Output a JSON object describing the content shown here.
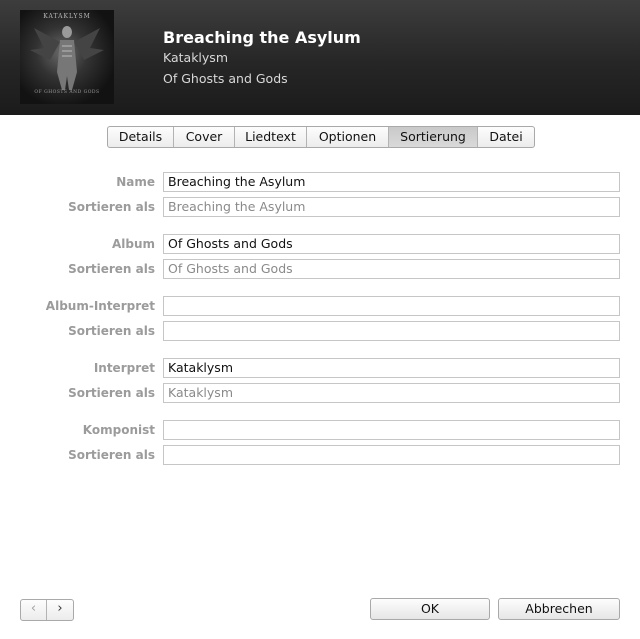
{
  "header": {
    "band_logo": "KATAKLYSM",
    "art_subtitle": "OF GHOSTS AND GODS",
    "title": "Breaching the Asylum",
    "artist": "Kataklysm",
    "album": "Of Ghosts and Gods"
  },
  "tabs": [
    {
      "label": "Details"
    },
    {
      "label": "Cover"
    },
    {
      "label": "Liedtext"
    },
    {
      "label": "Optionen"
    },
    {
      "label": "Sortierung"
    },
    {
      "label": "Datei"
    }
  ],
  "active_tab": "Sortierung",
  "fields": {
    "name": {
      "label": "Name",
      "value": "Breaching the Asylum"
    },
    "name_sort": {
      "label": "Sortieren als",
      "value": "Breaching the Asylum"
    },
    "album": {
      "label": "Album",
      "value": "Of Ghosts and Gods"
    },
    "album_sort": {
      "label": "Sortieren als",
      "value": "Of Ghosts and Gods"
    },
    "album_artist": {
      "label": "Album-Interpret",
      "value": ""
    },
    "album_artist_sort": {
      "label": "Sortieren als",
      "value": ""
    },
    "artist": {
      "label": "Interpret",
      "value": "Kataklysm"
    },
    "artist_sort": {
      "label": "Sortieren als",
      "value": "Kataklysm"
    },
    "composer": {
      "label": "Komponist",
      "value": ""
    },
    "composer_sort": {
      "label": "Sortieren als",
      "value": ""
    }
  },
  "footer": {
    "prev_icon": "‹",
    "next_icon": "›",
    "ok_label": "OK",
    "cancel_label": "Abbrechen"
  },
  "colors": {
    "header_bg": "#262626",
    "label_gray": "#9b9b9b",
    "active_tab": "#cfcfcf"
  }
}
